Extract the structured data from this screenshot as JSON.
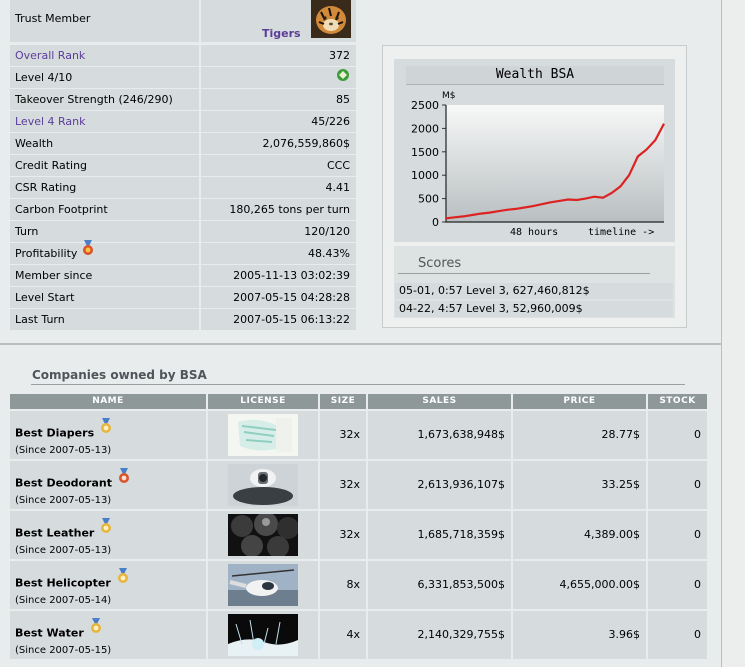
{
  "profile": {
    "trust_member_label": "Trust Member",
    "trust_name": "Tigers",
    "stats": [
      {
        "label": "Overall Rank",
        "value": "372",
        "link": true
      },
      {
        "label": "Level 4/10",
        "value": "",
        "icon": "level-badge-icon"
      },
      {
        "label": "Takeover Strength (246/290)",
        "value": "85"
      },
      {
        "label": "Level 4 Rank",
        "value": "45/226",
        "link": true
      },
      {
        "label": "Wealth",
        "value": "2,076,559,860$"
      },
      {
        "label": "Credit Rating",
        "value": "CCC"
      },
      {
        "label": "CSR Rating",
        "value": "4.41"
      },
      {
        "label": "Carbon Footprint",
        "value": "180,265 tons per turn"
      },
      {
        "label": "Turn",
        "value": "120/120"
      },
      {
        "label": "Profitability",
        "value": "48.43%",
        "icon": "profitability-medal-icon"
      },
      {
        "label": "Member since",
        "value": "2005-11-13 03:02:39"
      },
      {
        "label": "Level Start",
        "value": "2007-05-15 04:28:28"
      },
      {
        "label": "Last Turn",
        "value": "2007-05-15 06:13:22"
      }
    ]
  },
  "wealth_chart": {
    "title": "Wealth BSA",
    "unit_label": "M$",
    "x_label_left": "48 hours",
    "x_label_right": "timeline ->",
    "line_color": "#dd2222",
    "chart_data": {
      "type": "line",
      "title": "Wealth BSA",
      "ylabel": "M$",
      "xlabel": "48 hours",
      "ylim": [
        0,
        2500
      ],
      "yticks": [
        0,
        500,
        1000,
        1500,
        2000,
        2500
      ],
      "grid": true,
      "x": [
        0,
        4,
        8,
        12,
        16,
        20,
        24,
        28,
        32,
        36,
        40,
        44,
        48,
        52,
        56,
        60,
        64,
        68,
        72,
        76,
        80,
        84,
        88,
        92,
        96,
        100
      ],
      "series": [
        {
          "values": [
            80,
            100,
            120,
            150,
            180,
            200,
            230,
            260,
            280,
            310,
            340,
            380,
            420,
            450,
            480,
            470,
            500,
            540,
            520,
            620,
            760,
            1000,
            1400,
            1550,
            1750,
            2100
          ]
        }
      ]
    }
  },
  "scores": {
    "title": "Scores",
    "items": [
      "05-01, 0:57 Level 3, 627,460,812$",
      "04-22, 4:57 Level 3, 52,960,009$"
    ]
  },
  "companies": {
    "title": "Companies owned by BSA",
    "columns": [
      "NAME",
      "LICENSE",
      "SIZE",
      "SALES",
      "PRICE",
      "STOCK"
    ],
    "rows": [
      {
        "name": "Best Diapers",
        "since": "(Since 2007-05-13)",
        "size": "32x",
        "sales": "1,673,638,948$",
        "price": "28.77$",
        "stock": "0",
        "license_icon": "diapers-image"
      },
      {
        "name": "Best Deodorant",
        "since": "(Since 2007-05-13)",
        "size": "32x",
        "sales": "2,613,936,107$",
        "price": "33.25$",
        "stock": "0",
        "license_icon": "deodorant-image"
      },
      {
        "name": "Best Leather",
        "since": "(Since 2007-05-13)",
        "size": "32x",
        "sales": "1,685,718,359$",
        "price": "4,389.00$",
        "stock": "0",
        "license_icon": "leather-image"
      },
      {
        "name": "Best Helicopter",
        "since": "(Since 2007-05-14)",
        "size": "8x",
        "sales": "6,331,853,500$",
        "price": "4,655,000.00$",
        "stock": "0",
        "license_icon": "helicopter-image"
      },
      {
        "name": "Best Water",
        "since": "(Since 2007-05-15)",
        "size": "4x",
        "sales": "2,140,329,755$",
        "price": "3.96$",
        "stock": "0",
        "license_icon": "water-image"
      }
    ]
  }
}
